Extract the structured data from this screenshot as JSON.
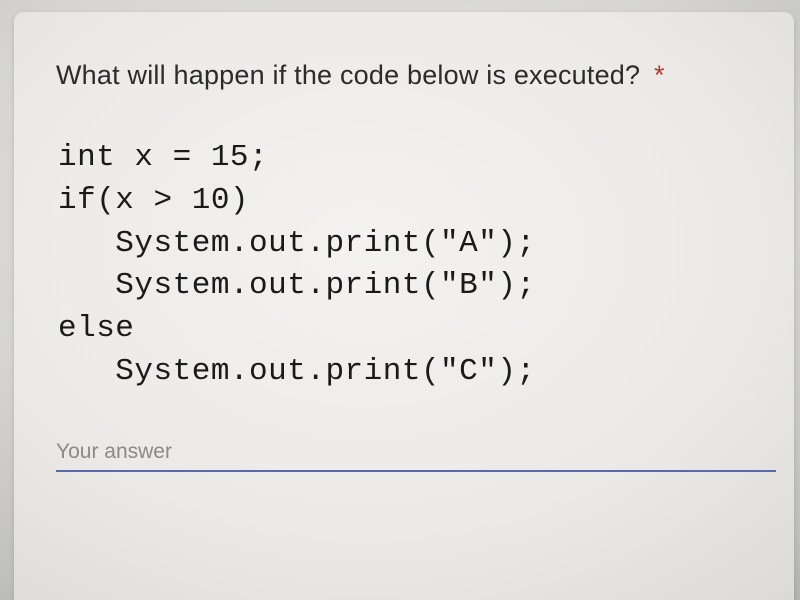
{
  "question": {
    "text": "What will happen if the code below is executed?",
    "required_marker": "*"
  },
  "code_lines": [
    "int x = 15;",
    "if(x > 10)",
    "   System.out.print(\"A\");",
    "   System.out.print(\"B\");",
    "else",
    "   System.out.print(\"C\");"
  ],
  "answer": {
    "placeholder": "Your answer",
    "value": ""
  }
}
